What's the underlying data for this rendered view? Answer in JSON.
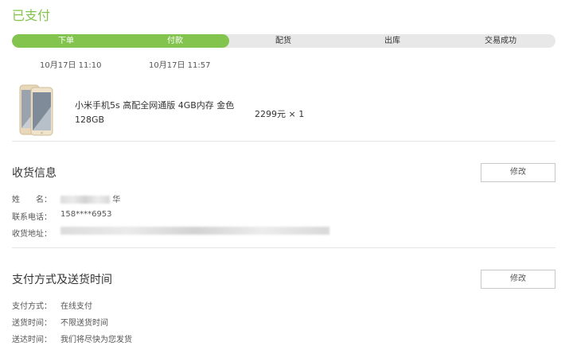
{
  "status": {
    "title": "已支付"
  },
  "progress": {
    "fraction": 0.4,
    "steps": [
      {
        "label": "下单",
        "time": "10月17日 11:10",
        "done": true
      },
      {
        "label": "付款",
        "time": "10月17日 11:57",
        "done": true
      },
      {
        "label": "配货",
        "done": false
      },
      {
        "label": "出库",
        "done": false
      },
      {
        "label": "交易成功",
        "done": false
      }
    ]
  },
  "product": {
    "name": "小米手机5s 高配全网通版 4GB内存 金色 128GB",
    "price_qty": "2299元 × 1"
  },
  "shipping": {
    "title": "收货信息",
    "edit_label": "修改",
    "name_label": "姓　　名：",
    "name_visible_suffix": "华",
    "phone_label": "联系电话：",
    "phone_value": "158****6953",
    "address_label": "收货地址："
  },
  "payment": {
    "title": "支付方式及送货时间",
    "edit_label": "修改",
    "method_label": "支付方式：",
    "method_value": "在线支付",
    "time_label": "送货时间：",
    "time_value": "不限送货时间",
    "delivery_label": "送达时间：",
    "delivery_value": "我们将尽快为您发货"
  },
  "colors": {
    "accent": "#83c44e",
    "track": "#e8e8e8"
  },
  "icons": {
    "product": "phone-image"
  }
}
